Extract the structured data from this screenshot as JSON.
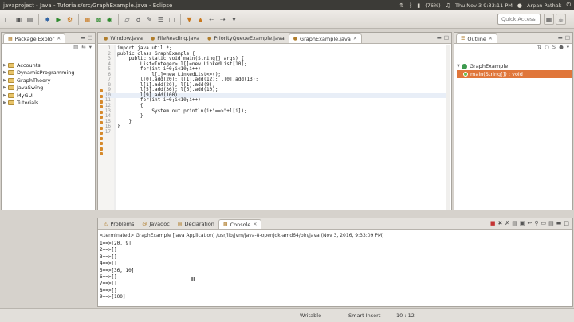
{
  "window": {
    "title": "javaproject - Java - Tutorials/src/GraphExample.java - Eclipse",
    "tray": {
      "battery": "(76%)",
      "clock": "Thu Nov 3  9:33:11 PM",
      "user": "Arpan Pathak"
    }
  },
  "toolbar": {
    "quick_access_placeholder": "Quick Access"
  },
  "package_explorer": {
    "tab_label": "Package Explor",
    "projects": [
      "Accounts",
      "DynamicProgramming",
      "GraphTheory",
      "JavaSwing",
      "MyGUI",
      "Tutorials"
    ]
  },
  "editor": {
    "tabs": [
      {
        "label": "Window.java",
        "active": false
      },
      {
        "label": "FileReading.java",
        "active": false
      },
      {
        "label": "PriorityQueueExample.java",
        "active": false
      },
      {
        "label": "GraphExample.java",
        "active": true
      }
    ],
    "lines": [
      {
        "n": "1",
        "text": "import java.util.*;"
      },
      {
        "n": "2",
        "text": "public class GraphExample {"
      },
      {
        "n": "3",
        "text": "    public static void main(String[] args) {"
      },
      {
        "n": "4",
        "text": "        List<Integer> l[]=new LinkedList[10];"
      },
      {
        "n": "5",
        "text": "        for(int i=0;i<10;i++)"
      },
      {
        "n": "6",
        "text": "            l[i]=new LinkedList<>();"
      },
      {
        "n": "7",
        "text": "        l[0].add(20); l[1].add(12); l[0].add(13);"
      },
      {
        "n": "8",
        "text": "        l[1].add(20); l[1].add(9);"
      },
      {
        "n": "9",
        "text": "        l[5].add(36); l[5].add(10);"
      },
      {
        "n": "10",
        "text": "        l[9].add(100);"
      },
      {
        "n": "11",
        "text": "        for(int i=0;i<10;i++)"
      },
      {
        "n": "12",
        "text": "        {"
      },
      {
        "n": "13",
        "text": "            System.out.println(i+\"==>\"+l[i]);"
      },
      {
        "n": "14",
        "text": "        }"
      },
      {
        "n": "15",
        "text": "    }"
      },
      {
        "n": "16",
        "text": "}"
      },
      {
        "n": "17",
        "text": ""
      }
    ]
  },
  "outline": {
    "tab_label": "Outline",
    "class_node": "GraphExample",
    "method_node": "main(String[]) : void"
  },
  "console": {
    "tabs": [
      {
        "label": "Problems",
        "active": false
      },
      {
        "label": "Javadoc",
        "active": false
      },
      {
        "label": "Declaration",
        "active": false
      },
      {
        "label": "Console",
        "active": true
      }
    ],
    "terminated": "<terminated> GraphExample [Java Application] /usr/lib/jvm/java-8-openjdk-amd64/bin/java (Nov 3, 2016, 9:33:09 PM)",
    "output": [
      "1==>[20, 9]",
      "2==>[]",
      "3==>[]",
      "4==>[]",
      "5==>[36, 10]",
      "6==>[]",
      "7==>[]",
      "8==>[]",
      "9==>[100]"
    ]
  },
  "statusbar": {
    "writable": "Writable",
    "insert_mode": "Smart Insert",
    "position": "10 : 12"
  }
}
